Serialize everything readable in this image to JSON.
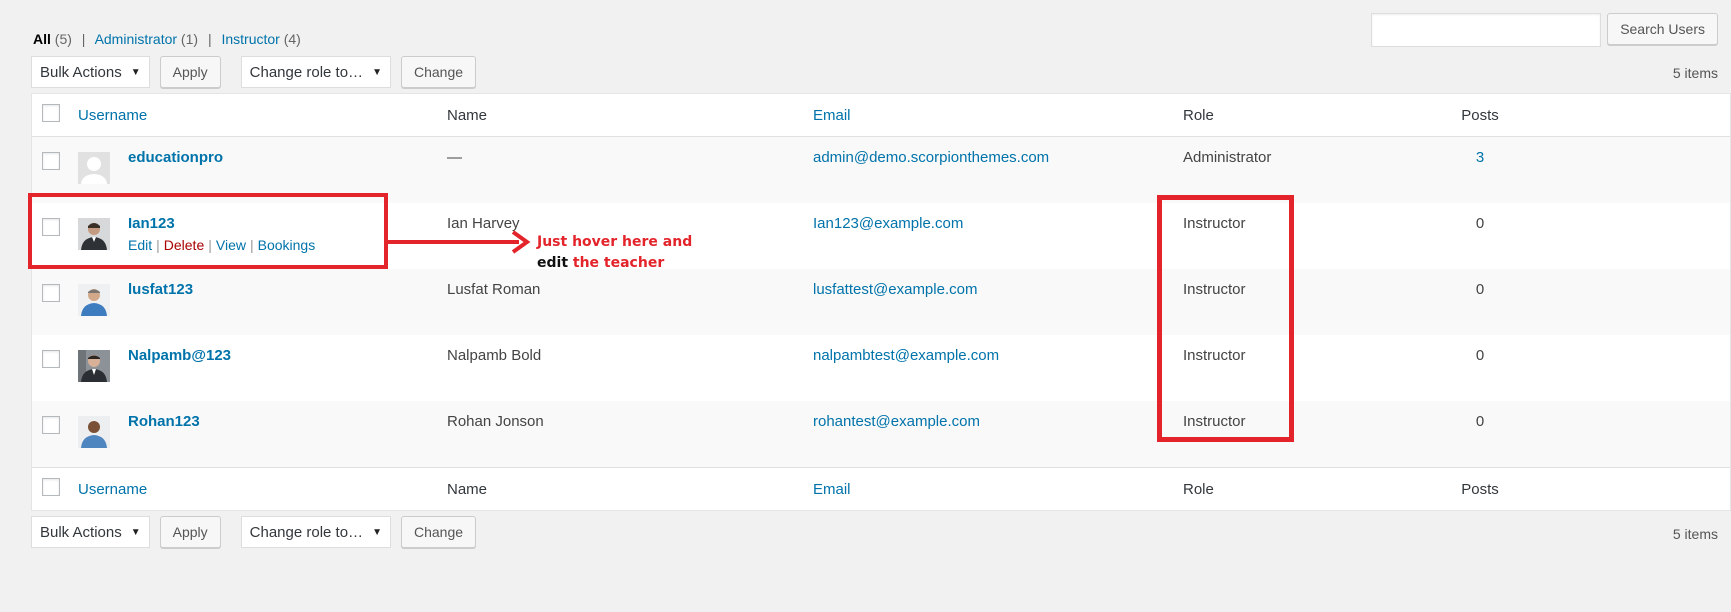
{
  "filters": {
    "all_label": "All",
    "all_count": "(5)",
    "separator": "|",
    "administrator_label": "Administrator",
    "administrator_count": "(1)",
    "instructor_label": "Instructor",
    "instructor_count": "(4)"
  },
  "search": {
    "value": "",
    "button_label": "Search Users"
  },
  "tablenav": {
    "bulk_actions": "Bulk Actions",
    "apply_label": "Apply",
    "change_role": "Change role to…",
    "change_label": "Change",
    "items_count": "5 items"
  },
  "columns": {
    "username": "Username",
    "name": "Name",
    "email": "Email",
    "role": "Role",
    "posts": "Posts"
  },
  "users": [
    {
      "username": "educationpro",
      "name": "—",
      "email": "admin@demo.scorpionthemes.com",
      "role": "Administrator",
      "posts": "3",
      "avatar": "default-avatar"
    },
    {
      "username": "Ian123",
      "name": "Ian Harvey",
      "email": "Ian123@example.com",
      "role": "Instructor",
      "posts": "0",
      "avatar": "photo-avatar"
    },
    {
      "username": "lusfat123",
      "name": "Lusfat Roman",
      "email": "lusfattest@example.com",
      "role": "Instructor",
      "posts": "0",
      "avatar": "photo-avatar"
    },
    {
      "username": "Nalpamb@123",
      "name": "Nalpamb Bold",
      "email": "nalpambtest@example.com",
      "role": "Instructor",
      "posts": "0",
      "avatar": "photo-avatar"
    },
    {
      "username": "Rohan123",
      "name": "Rohan Jonson",
      "email": "rohantest@example.com",
      "role": "Instructor",
      "posts": "0",
      "avatar": "photo-avatar"
    }
  ],
  "row_actions": {
    "edit": "Edit",
    "delete": "Delete",
    "view": "View",
    "bookings": "Bookings",
    "pipe": "|"
  },
  "annotation": {
    "line1": "Just hover  here and",
    "line2_black": "edit",
    "line2_red": "the teacher",
    "color": "#e4242b"
  },
  "colors": {
    "link": "#0073aa",
    "delete": "#aa0000",
    "background": "#f1f1f1"
  }
}
